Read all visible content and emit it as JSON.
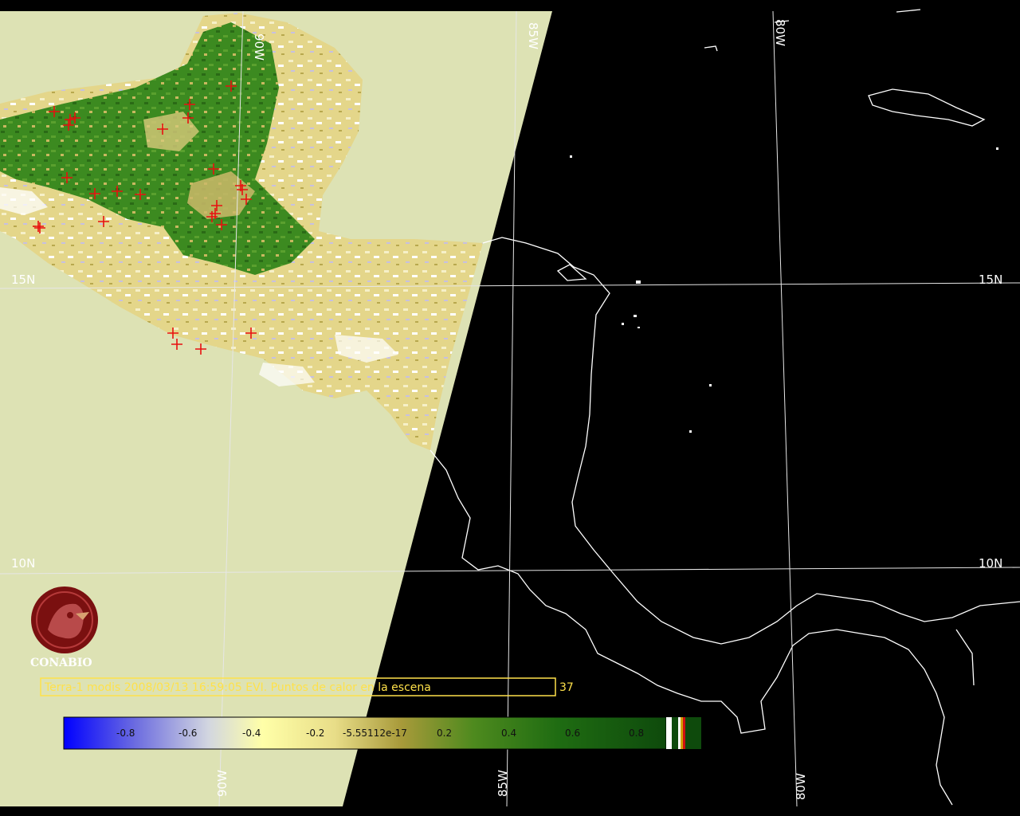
{
  "lat_labels": [
    "15N",
    "10N"
  ],
  "lon_labels": [
    "90W",
    "85W",
    "80W"
  ],
  "logo": {
    "name": "CONABIO"
  },
  "caption": {
    "text": "Terra-1 modis 2008/03/13 16:59:05 EVI. Puntos de calor en la escena",
    "count": "37"
  },
  "colorbar": {
    "ticks": [
      "-0.8",
      "-0.6",
      "-0.4",
      "-0.2",
      "-5.55112e-17",
      "0.2",
      "0.4",
      "0.6",
      "0.8"
    ]
  },
  "hotspot_count_shown": 37,
  "colors": {
    "no_data": "#dde2b4",
    "background": "#000000",
    "coastline": "#ffffff",
    "gridline": "#e6e6e6",
    "hotspot": "#e81010",
    "caption": "#ffe14a",
    "logo": "#7a1010"
  }
}
